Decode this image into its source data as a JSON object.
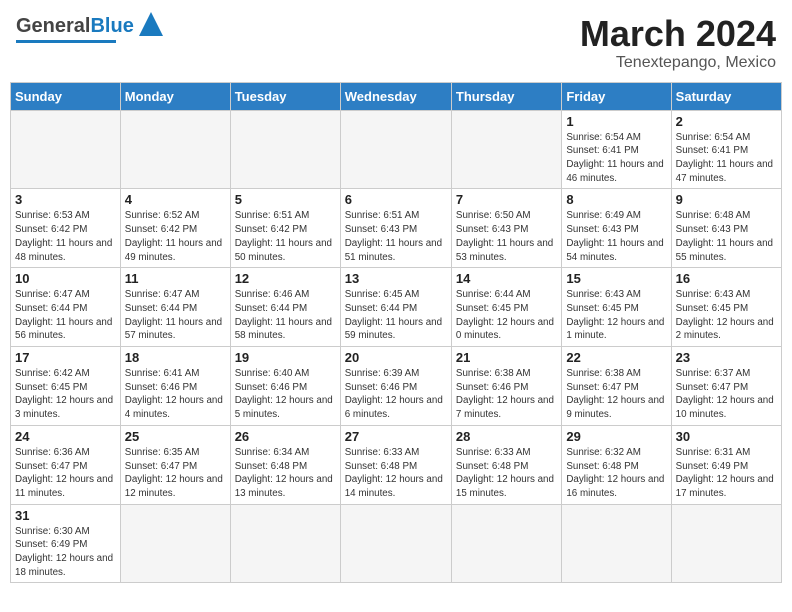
{
  "header": {
    "logo_general": "General",
    "logo_blue": "Blue",
    "title": "March 2024",
    "subtitle": "Tenextepango, Mexico"
  },
  "calendar": {
    "days_of_week": [
      "Sunday",
      "Monday",
      "Tuesday",
      "Wednesday",
      "Thursday",
      "Friday",
      "Saturday"
    ],
    "weeks": [
      [
        {
          "day": "",
          "info": ""
        },
        {
          "day": "",
          "info": ""
        },
        {
          "day": "",
          "info": ""
        },
        {
          "day": "",
          "info": ""
        },
        {
          "day": "",
          "info": ""
        },
        {
          "day": "1",
          "info": "Sunrise: 6:54 AM\nSunset: 6:41 PM\nDaylight: 11 hours and 46 minutes."
        },
        {
          "day": "2",
          "info": "Sunrise: 6:54 AM\nSunset: 6:41 PM\nDaylight: 11 hours and 47 minutes."
        }
      ],
      [
        {
          "day": "3",
          "info": "Sunrise: 6:53 AM\nSunset: 6:42 PM\nDaylight: 11 hours and 48 minutes."
        },
        {
          "day": "4",
          "info": "Sunrise: 6:52 AM\nSunset: 6:42 PM\nDaylight: 11 hours and 49 minutes."
        },
        {
          "day": "5",
          "info": "Sunrise: 6:51 AM\nSunset: 6:42 PM\nDaylight: 11 hours and 50 minutes."
        },
        {
          "day": "6",
          "info": "Sunrise: 6:51 AM\nSunset: 6:43 PM\nDaylight: 11 hours and 51 minutes."
        },
        {
          "day": "7",
          "info": "Sunrise: 6:50 AM\nSunset: 6:43 PM\nDaylight: 11 hours and 53 minutes."
        },
        {
          "day": "8",
          "info": "Sunrise: 6:49 AM\nSunset: 6:43 PM\nDaylight: 11 hours and 54 minutes."
        },
        {
          "day": "9",
          "info": "Sunrise: 6:48 AM\nSunset: 6:43 PM\nDaylight: 11 hours and 55 minutes."
        }
      ],
      [
        {
          "day": "10",
          "info": "Sunrise: 6:47 AM\nSunset: 6:44 PM\nDaylight: 11 hours and 56 minutes."
        },
        {
          "day": "11",
          "info": "Sunrise: 6:47 AM\nSunset: 6:44 PM\nDaylight: 11 hours and 57 minutes."
        },
        {
          "day": "12",
          "info": "Sunrise: 6:46 AM\nSunset: 6:44 PM\nDaylight: 11 hours and 58 minutes."
        },
        {
          "day": "13",
          "info": "Sunrise: 6:45 AM\nSunset: 6:44 PM\nDaylight: 11 hours and 59 minutes."
        },
        {
          "day": "14",
          "info": "Sunrise: 6:44 AM\nSunset: 6:45 PM\nDaylight: 12 hours and 0 minutes."
        },
        {
          "day": "15",
          "info": "Sunrise: 6:43 AM\nSunset: 6:45 PM\nDaylight: 12 hours and 1 minute."
        },
        {
          "day": "16",
          "info": "Sunrise: 6:43 AM\nSunset: 6:45 PM\nDaylight: 12 hours and 2 minutes."
        }
      ],
      [
        {
          "day": "17",
          "info": "Sunrise: 6:42 AM\nSunset: 6:45 PM\nDaylight: 12 hours and 3 minutes."
        },
        {
          "day": "18",
          "info": "Sunrise: 6:41 AM\nSunset: 6:46 PM\nDaylight: 12 hours and 4 minutes."
        },
        {
          "day": "19",
          "info": "Sunrise: 6:40 AM\nSunset: 6:46 PM\nDaylight: 12 hours and 5 minutes."
        },
        {
          "day": "20",
          "info": "Sunrise: 6:39 AM\nSunset: 6:46 PM\nDaylight: 12 hours and 6 minutes."
        },
        {
          "day": "21",
          "info": "Sunrise: 6:38 AM\nSunset: 6:46 PM\nDaylight: 12 hours and 7 minutes."
        },
        {
          "day": "22",
          "info": "Sunrise: 6:38 AM\nSunset: 6:47 PM\nDaylight: 12 hours and 9 minutes."
        },
        {
          "day": "23",
          "info": "Sunrise: 6:37 AM\nSunset: 6:47 PM\nDaylight: 12 hours and 10 minutes."
        }
      ],
      [
        {
          "day": "24",
          "info": "Sunrise: 6:36 AM\nSunset: 6:47 PM\nDaylight: 12 hours and 11 minutes."
        },
        {
          "day": "25",
          "info": "Sunrise: 6:35 AM\nSunset: 6:47 PM\nDaylight: 12 hours and 12 minutes."
        },
        {
          "day": "26",
          "info": "Sunrise: 6:34 AM\nSunset: 6:48 PM\nDaylight: 12 hours and 13 minutes."
        },
        {
          "day": "27",
          "info": "Sunrise: 6:33 AM\nSunset: 6:48 PM\nDaylight: 12 hours and 14 minutes."
        },
        {
          "day": "28",
          "info": "Sunrise: 6:33 AM\nSunset: 6:48 PM\nDaylight: 12 hours and 15 minutes."
        },
        {
          "day": "29",
          "info": "Sunrise: 6:32 AM\nSunset: 6:48 PM\nDaylight: 12 hours and 16 minutes."
        },
        {
          "day": "30",
          "info": "Sunrise: 6:31 AM\nSunset: 6:49 PM\nDaylight: 12 hours and 17 minutes."
        }
      ],
      [
        {
          "day": "31",
          "info": "Sunrise: 6:30 AM\nSunset: 6:49 PM\nDaylight: 12 hours and 18 minutes."
        },
        {
          "day": "",
          "info": ""
        },
        {
          "day": "",
          "info": ""
        },
        {
          "day": "",
          "info": ""
        },
        {
          "day": "",
          "info": ""
        },
        {
          "day": "",
          "info": ""
        },
        {
          "day": "",
          "info": ""
        }
      ]
    ]
  }
}
